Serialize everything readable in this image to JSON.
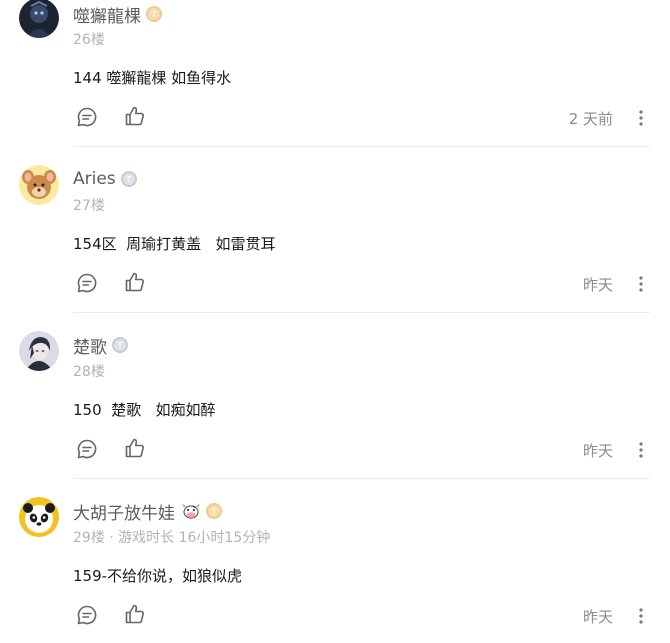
{
  "comments": [
    {
      "username": "噬獬龍棵",
      "floor": "26楼",
      "content": "144 噬獬龍棵 如鱼得水",
      "time": "2 天前",
      "badge_color": "#f5c98a"
    },
    {
      "username": "Aries",
      "floor": "27楼",
      "content": "154区  周瑜打黄盖   如雷贯耳",
      "time": "昨天",
      "badge_color": "#c5cad4"
    },
    {
      "username": "楚歌",
      "floor": "28楼",
      "content": "150  楚歌   如痴如醉",
      "time": "昨天",
      "badge_color": "#c5cad4"
    },
    {
      "username": "大胡子放牛娃",
      "floor": "29楼 · 游戏时长 16小时15分钟",
      "content": "159-不给你说，如狼似虎",
      "time": "昨天",
      "badge_color": "#f5c98a"
    }
  ],
  "icons": {
    "reply": "comment-bubble-icon",
    "like": "thumbs-up-icon",
    "more": "more-vertical-icon",
    "badge": "level-badge-icon",
    "cow": "cow-emoji-icon"
  }
}
